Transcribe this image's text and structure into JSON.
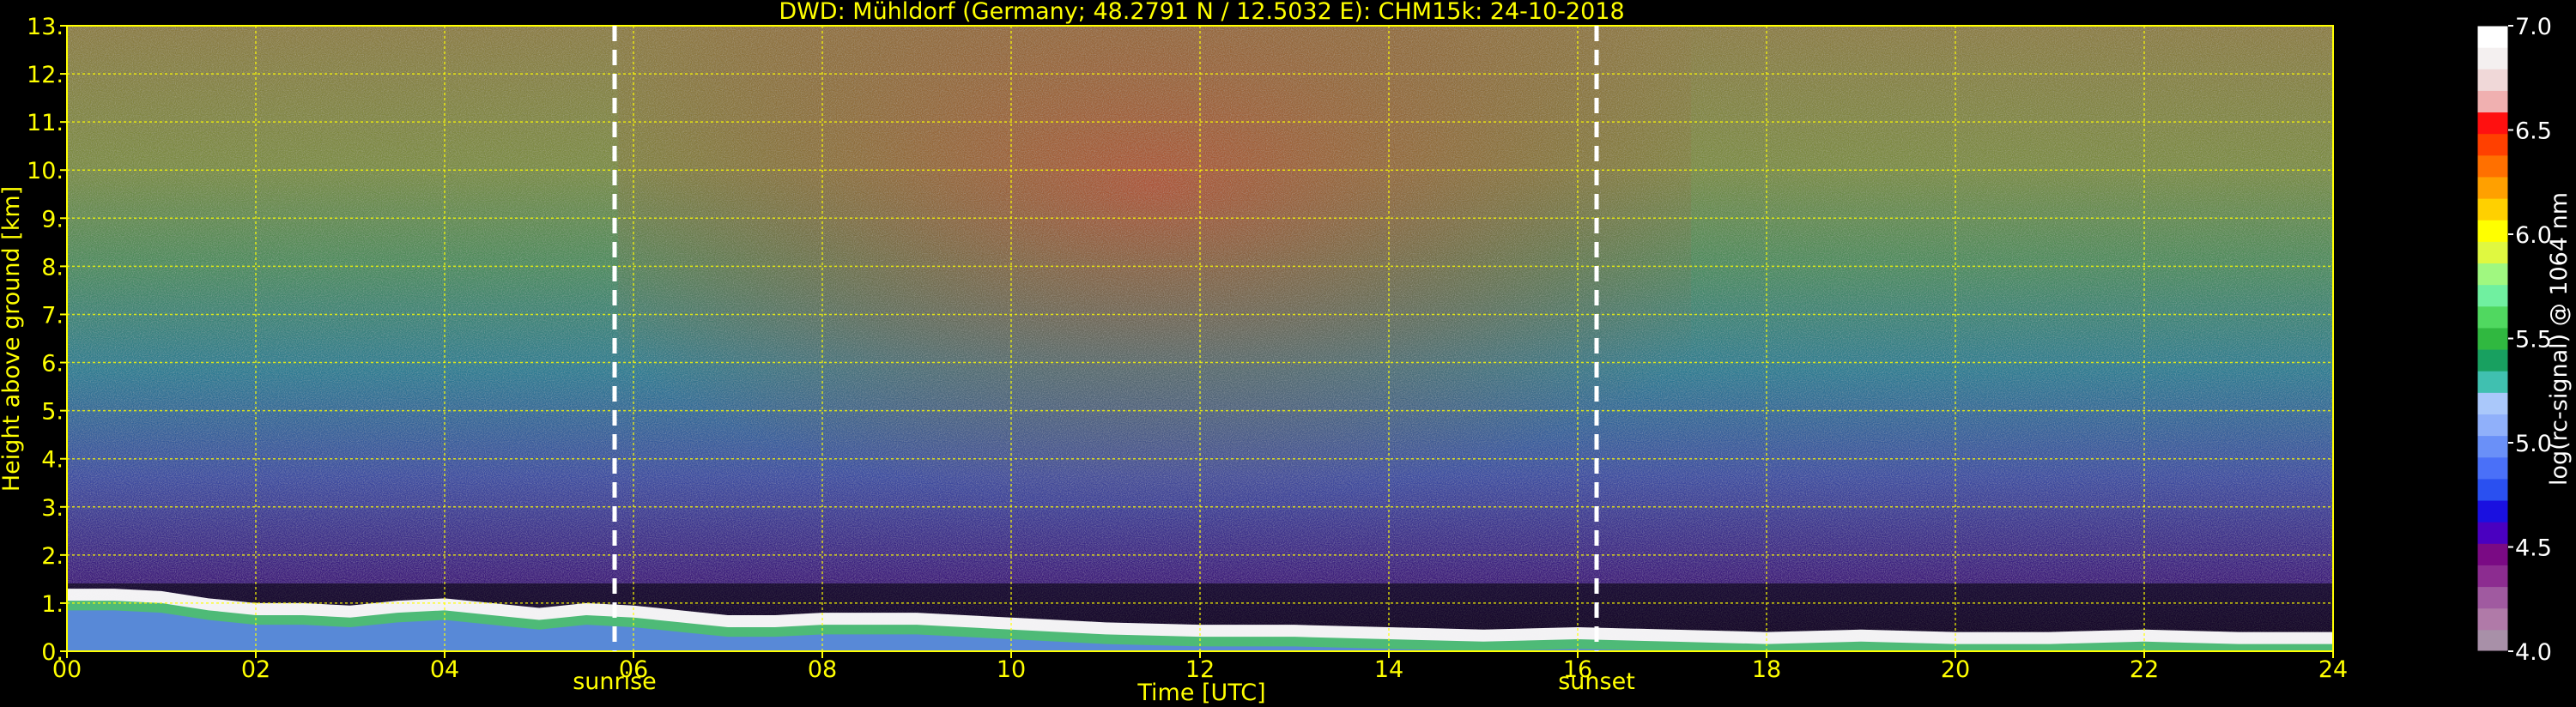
{
  "chart_data": {
    "type": "heatmap",
    "title": "DWD: Mühldorf (Germany; 48.2791 N / 12.5032 E):    CHM15k: 24-10-2018",
    "xlabel": "Time [UTC]",
    "ylabel": "Height above ground [km]",
    "xlim": [
      0,
      24
    ],
    "ylim": [
      0,
      13
    ],
    "x_ticks": [
      "00",
      "02",
      "04",
      "06",
      "08",
      "10",
      "12",
      "14",
      "16",
      "18",
      "20",
      "22",
      "24"
    ],
    "y_ticks": [
      "0.",
      "1.",
      "2.",
      "3.",
      "4.",
      "5.",
      "6.",
      "7.",
      "8.",
      "9.",
      "10.",
      "11.",
      "12.",
      "13."
    ],
    "grid": true,
    "annotations": [
      {
        "label": "sunrise",
        "x": 5.8
      },
      {
        "label": "sunset",
        "x": 16.2
      }
    ],
    "colorbar": {
      "label": "log(rc-signal) @ 1064 nm",
      "min": 4.0,
      "max": 7.0,
      "ticks": [
        "4.0",
        "4.5",
        "5.0",
        "5.5",
        "6.0",
        "6.5",
        "7.0"
      ],
      "colors": [
        "#a890a8",
        "#b07aa8",
        "#a05aa0",
        "#8c2c90",
        "#7a0a84",
        "#4a00c0",
        "#1a10e0",
        "#2a50f0",
        "#4a70f8",
        "#6a90f8",
        "#90b0fa",
        "#aac8fa",
        "#40c0b0",
        "#18a060",
        "#30b840",
        "#50d860",
        "#70f0a0",
        "#a0f880",
        "#e0f840",
        "#ffff00",
        "#ffd000",
        "#ffa000",
        "#ff7000",
        "#ff4000",
        "#ff1010",
        "#f0b0b0",
        "#f0d8d8",
        "#f4f0f0",
        "#ffffff"
      ]
    },
    "cloud_base_profile": {
      "x": [
        0,
        0.5,
        1,
        1.5,
        2,
        2.5,
        3,
        3.5,
        4,
        4.5,
        5,
        5.5,
        6,
        6.5,
        7,
        7.5,
        8,
        8.5,
        9,
        10,
        11,
        12,
        13,
        14,
        15,
        16,
        17,
        18,
        19,
        20,
        21,
        22,
        23,
        24
      ],
      "y": [
        1.3,
        1.3,
        1.25,
        1.1,
        1.0,
        1.0,
        0.95,
        1.05,
        1.1,
        1.0,
        0.9,
        1.0,
        0.95,
        0.85,
        0.75,
        0.75,
        0.8,
        0.8,
        0.8,
        0.7,
        0.6,
        0.55,
        0.55,
        0.5,
        0.45,
        0.5,
        0.45,
        0.4,
        0.45,
        0.4,
        0.4,
        0.45,
        0.4,
        0.4
      ]
    }
  }
}
